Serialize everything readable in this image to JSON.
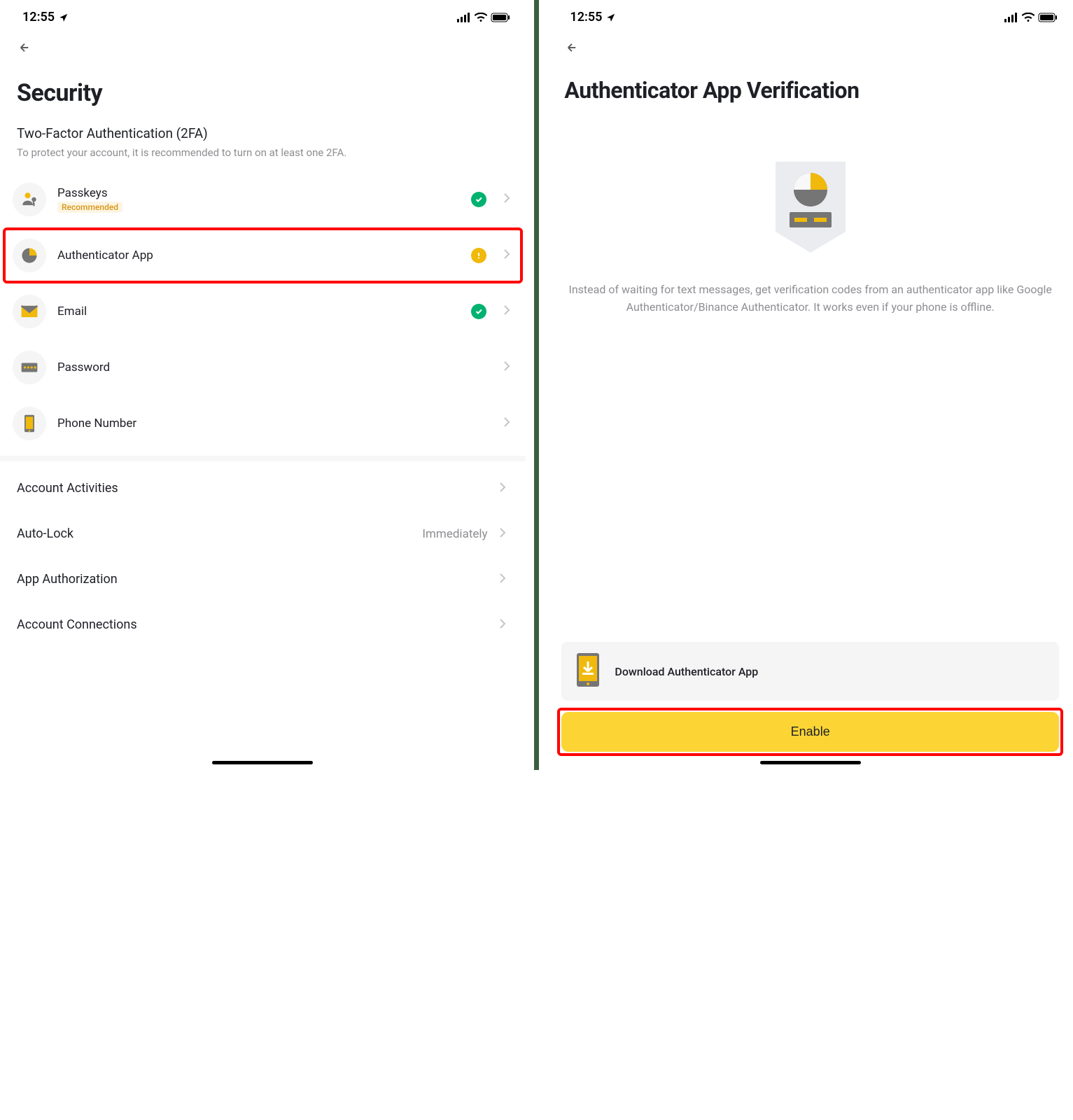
{
  "status_bar": {
    "time": "12:55"
  },
  "left": {
    "title": "Security",
    "tfa_heading": "Two-Factor Authentication (2FA)",
    "tfa_sub": "To protect your account, it is recommended to turn on at least one 2FA.",
    "items": [
      {
        "label": "Passkeys",
        "badge": "Recommended",
        "status": "green"
      },
      {
        "label": "Authenticator App",
        "status": "amber"
      },
      {
        "label": "Email",
        "status": "green"
      },
      {
        "label": "Password"
      },
      {
        "label": "Phone Number"
      }
    ],
    "other": [
      {
        "label": "Account Activities"
      },
      {
        "label": "Auto-Lock",
        "value": "Immediately"
      },
      {
        "label": "App Authorization"
      },
      {
        "label": "Account Connections"
      }
    ]
  },
  "right": {
    "title": "Authenticator App Verification",
    "desc": "Instead of waiting for text messages, get verification codes from an authenticator app like Google Authenticator/Binance Authenticator. It works even if your phone is offline.",
    "download_label": "Download Authenticator App",
    "enable_label": "Enable"
  }
}
